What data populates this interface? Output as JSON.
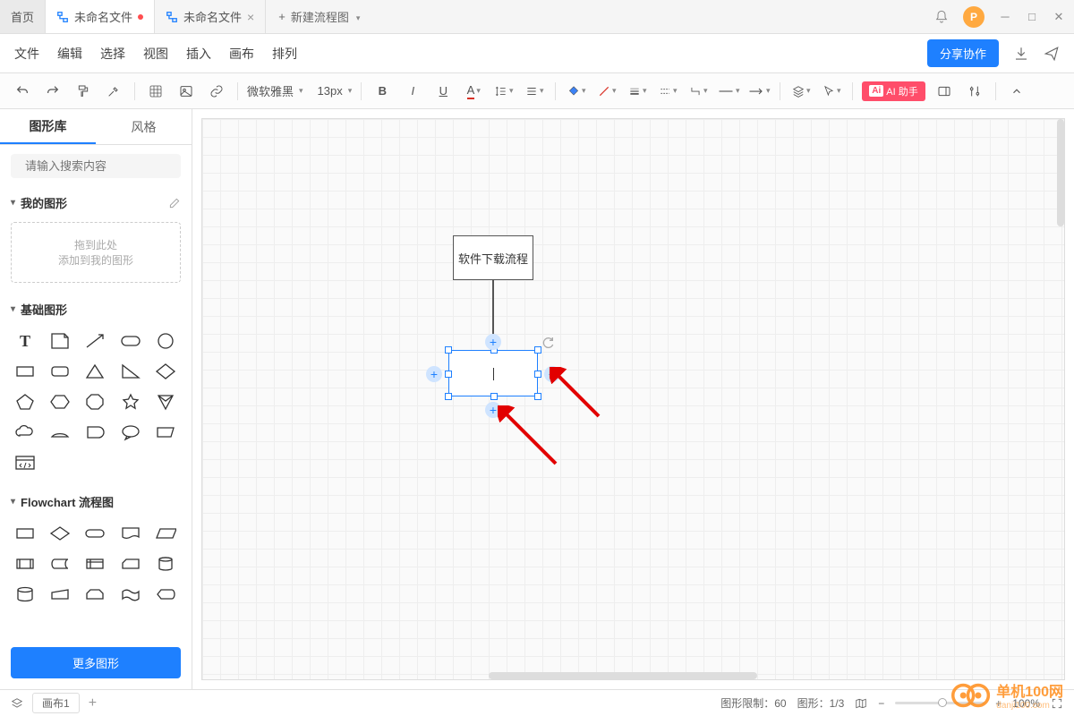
{
  "titlebar": {
    "home": "首页",
    "tabs": [
      {
        "label": "未命名文件",
        "modified": true,
        "active": true
      },
      {
        "label": "未命名文件",
        "modified": false,
        "active": false
      }
    ],
    "new_tab": "新建流程图",
    "avatar_letter": "P"
  },
  "menubar": {
    "items": [
      "文件",
      "编辑",
      "选择",
      "视图",
      "插入",
      "画布",
      "排列"
    ],
    "share": "分享协作"
  },
  "toolbar": {
    "font_family": "微软雅黑",
    "font_size": "13px",
    "ai_label": "AI 助手",
    "ai_icon": "Ai"
  },
  "sidebar": {
    "tabs": [
      "图形库",
      "风格"
    ],
    "search_placeholder": "请输入搜索内容",
    "sections": {
      "my": {
        "title": "我的图形",
        "drop1": "拖到此处",
        "drop2": "添加到我的图形"
      },
      "basic": {
        "title": "基础图形"
      },
      "flowchart": {
        "title": "Flowchart 流程图"
      }
    },
    "more": "更多图形"
  },
  "canvas": {
    "node1_text": "软件下载流程"
  },
  "statusbar": {
    "page_label": "画布1",
    "limit_label": "图形限制：",
    "limit_value": "60",
    "count_label": "图形：",
    "count_value": "1/3",
    "zoom": "100%"
  },
  "watermark": {
    "brand": "单机100网",
    "url": "danji100.com"
  }
}
